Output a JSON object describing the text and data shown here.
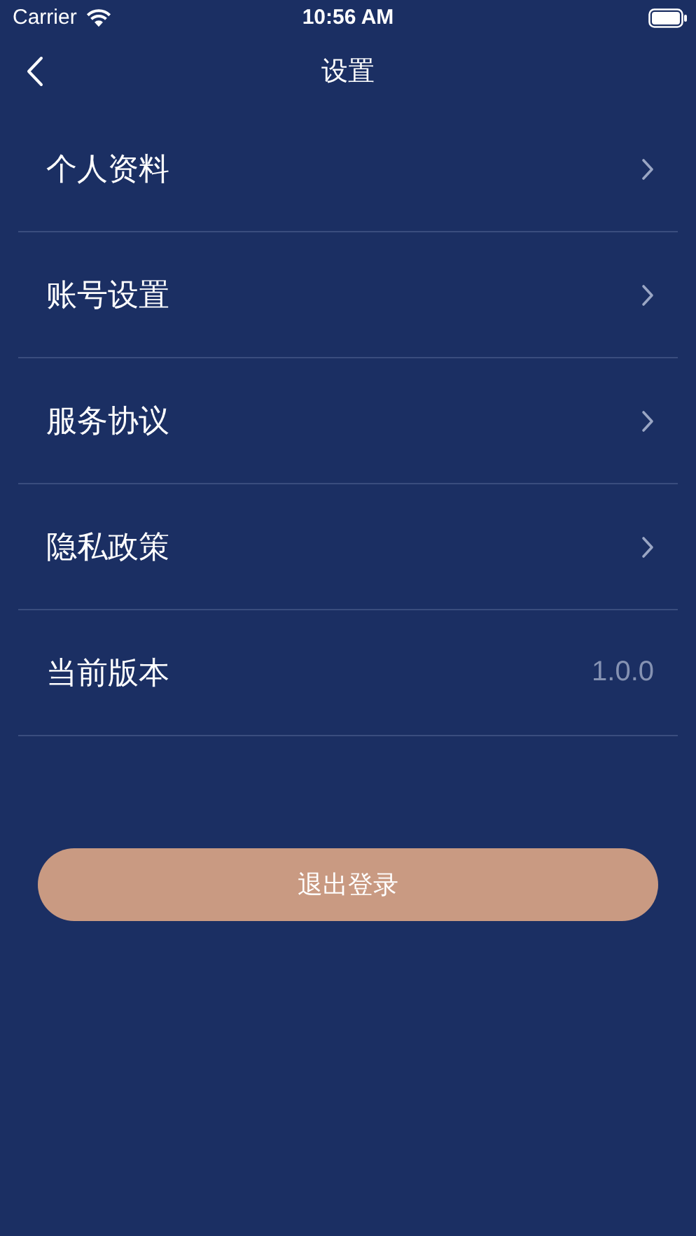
{
  "status_bar": {
    "carrier": "Carrier",
    "time": "10:56 AM"
  },
  "nav": {
    "title": "设置"
  },
  "rows": [
    {
      "kind": "link",
      "label": "个人资料"
    },
    {
      "kind": "link",
      "label": "账号设置"
    },
    {
      "kind": "link",
      "label": "服务协议"
    },
    {
      "kind": "link",
      "label": "隐私政策"
    },
    {
      "kind": "value",
      "label": "当前版本",
      "value": "1.0.0"
    }
  ],
  "logout_button": {
    "label": "退出登录"
  }
}
